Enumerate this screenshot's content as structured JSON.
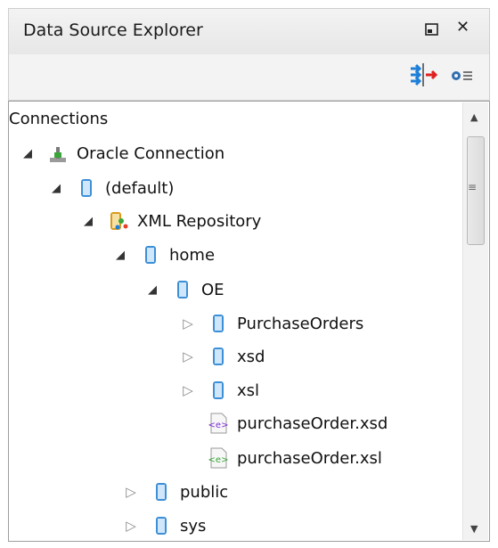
{
  "panel": {
    "title": "Data Source Explorer",
    "minimize_icon": "minimize-icon",
    "close_icon": "close-icon"
  },
  "toolbar": {
    "filter_icon": "compare-arrows-icon",
    "menu_icon": "gear-menu-icon"
  },
  "tree": {
    "root": "Connections",
    "oracle_connection": "Oracle Connection",
    "default": "(default)",
    "xml_repository": "XML Repository",
    "home": "home",
    "oe": "OE",
    "purchase_orders": "PurchaseOrders",
    "xsd": "xsd",
    "xsl": "xsl",
    "purchase_order_xsd": "purchaseOrder.xsd",
    "purchase_order_xsl": "purchaseOrder.xsl",
    "public": "public",
    "sys": "sys"
  },
  "colors": {
    "accent": "#1e7fd8",
    "db_blue": "#3d8fd6"
  }
}
